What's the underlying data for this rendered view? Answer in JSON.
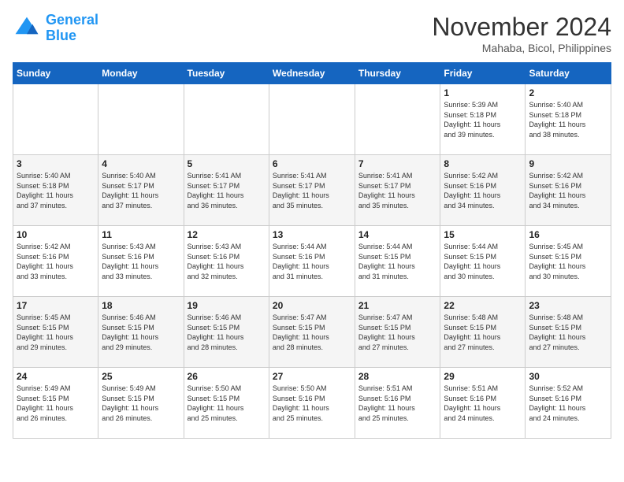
{
  "logo": {
    "line1": "General",
    "line2": "Blue"
  },
  "title": "November 2024",
  "subtitle": "Mahaba, Bicol, Philippines",
  "headers": [
    "Sunday",
    "Monday",
    "Tuesday",
    "Wednesday",
    "Thursday",
    "Friday",
    "Saturday"
  ],
  "weeks": [
    [
      {
        "day": "",
        "info": ""
      },
      {
        "day": "",
        "info": ""
      },
      {
        "day": "",
        "info": ""
      },
      {
        "day": "",
        "info": ""
      },
      {
        "day": "",
        "info": ""
      },
      {
        "day": "1",
        "info": "Sunrise: 5:39 AM\nSunset: 5:18 PM\nDaylight: 11 hours\nand 39 minutes."
      },
      {
        "day": "2",
        "info": "Sunrise: 5:40 AM\nSunset: 5:18 PM\nDaylight: 11 hours\nand 38 minutes."
      }
    ],
    [
      {
        "day": "3",
        "info": "Sunrise: 5:40 AM\nSunset: 5:18 PM\nDaylight: 11 hours\nand 37 minutes."
      },
      {
        "day": "4",
        "info": "Sunrise: 5:40 AM\nSunset: 5:17 PM\nDaylight: 11 hours\nand 37 minutes."
      },
      {
        "day": "5",
        "info": "Sunrise: 5:41 AM\nSunset: 5:17 PM\nDaylight: 11 hours\nand 36 minutes."
      },
      {
        "day": "6",
        "info": "Sunrise: 5:41 AM\nSunset: 5:17 PM\nDaylight: 11 hours\nand 35 minutes."
      },
      {
        "day": "7",
        "info": "Sunrise: 5:41 AM\nSunset: 5:17 PM\nDaylight: 11 hours\nand 35 minutes."
      },
      {
        "day": "8",
        "info": "Sunrise: 5:42 AM\nSunset: 5:16 PM\nDaylight: 11 hours\nand 34 minutes."
      },
      {
        "day": "9",
        "info": "Sunrise: 5:42 AM\nSunset: 5:16 PM\nDaylight: 11 hours\nand 34 minutes."
      }
    ],
    [
      {
        "day": "10",
        "info": "Sunrise: 5:42 AM\nSunset: 5:16 PM\nDaylight: 11 hours\nand 33 minutes."
      },
      {
        "day": "11",
        "info": "Sunrise: 5:43 AM\nSunset: 5:16 PM\nDaylight: 11 hours\nand 33 minutes."
      },
      {
        "day": "12",
        "info": "Sunrise: 5:43 AM\nSunset: 5:16 PM\nDaylight: 11 hours\nand 32 minutes."
      },
      {
        "day": "13",
        "info": "Sunrise: 5:44 AM\nSunset: 5:16 PM\nDaylight: 11 hours\nand 31 minutes."
      },
      {
        "day": "14",
        "info": "Sunrise: 5:44 AM\nSunset: 5:15 PM\nDaylight: 11 hours\nand 31 minutes."
      },
      {
        "day": "15",
        "info": "Sunrise: 5:44 AM\nSunset: 5:15 PM\nDaylight: 11 hours\nand 30 minutes."
      },
      {
        "day": "16",
        "info": "Sunrise: 5:45 AM\nSunset: 5:15 PM\nDaylight: 11 hours\nand 30 minutes."
      }
    ],
    [
      {
        "day": "17",
        "info": "Sunrise: 5:45 AM\nSunset: 5:15 PM\nDaylight: 11 hours\nand 29 minutes."
      },
      {
        "day": "18",
        "info": "Sunrise: 5:46 AM\nSunset: 5:15 PM\nDaylight: 11 hours\nand 29 minutes."
      },
      {
        "day": "19",
        "info": "Sunrise: 5:46 AM\nSunset: 5:15 PM\nDaylight: 11 hours\nand 28 minutes."
      },
      {
        "day": "20",
        "info": "Sunrise: 5:47 AM\nSunset: 5:15 PM\nDaylight: 11 hours\nand 28 minutes."
      },
      {
        "day": "21",
        "info": "Sunrise: 5:47 AM\nSunset: 5:15 PM\nDaylight: 11 hours\nand 27 minutes."
      },
      {
        "day": "22",
        "info": "Sunrise: 5:48 AM\nSunset: 5:15 PM\nDaylight: 11 hours\nand 27 minutes."
      },
      {
        "day": "23",
        "info": "Sunrise: 5:48 AM\nSunset: 5:15 PM\nDaylight: 11 hours\nand 27 minutes."
      }
    ],
    [
      {
        "day": "24",
        "info": "Sunrise: 5:49 AM\nSunset: 5:15 PM\nDaylight: 11 hours\nand 26 minutes."
      },
      {
        "day": "25",
        "info": "Sunrise: 5:49 AM\nSunset: 5:15 PM\nDaylight: 11 hours\nand 26 minutes."
      },
      {
        "day": "26",
        "info": "Sunrise: 5:50 AM\nSunset: 5:15 PM\nDaylight: 11 hours\nand 25 minutes."
      },
      {
        "day": "27",
        "info": "Sunrise: 5:50 AM\nSunset: 5:16 PM\nDaylight: 11 hours\nand 25 minutes."
      },
      {
        "day": "28",
        "info": "Sunrise: 5:51 AM\nSunset: 5:16 PM\nDaylight: 11 hours\nand 25 minutes."
      },
      {
        "day": "29",
        "info": "Sunrise: 5:51 AM\nSunset: 5:16 PM\nDaylight: 11 hours\nand 24 minutes."
      },
      {
        "day": "30",
        "info": "Sunrise: 5:52 AM\nSunset: 5:16 PM\nDaylight: 11 hours\nand 24 minutes."
      }
    ]
  ]
}
